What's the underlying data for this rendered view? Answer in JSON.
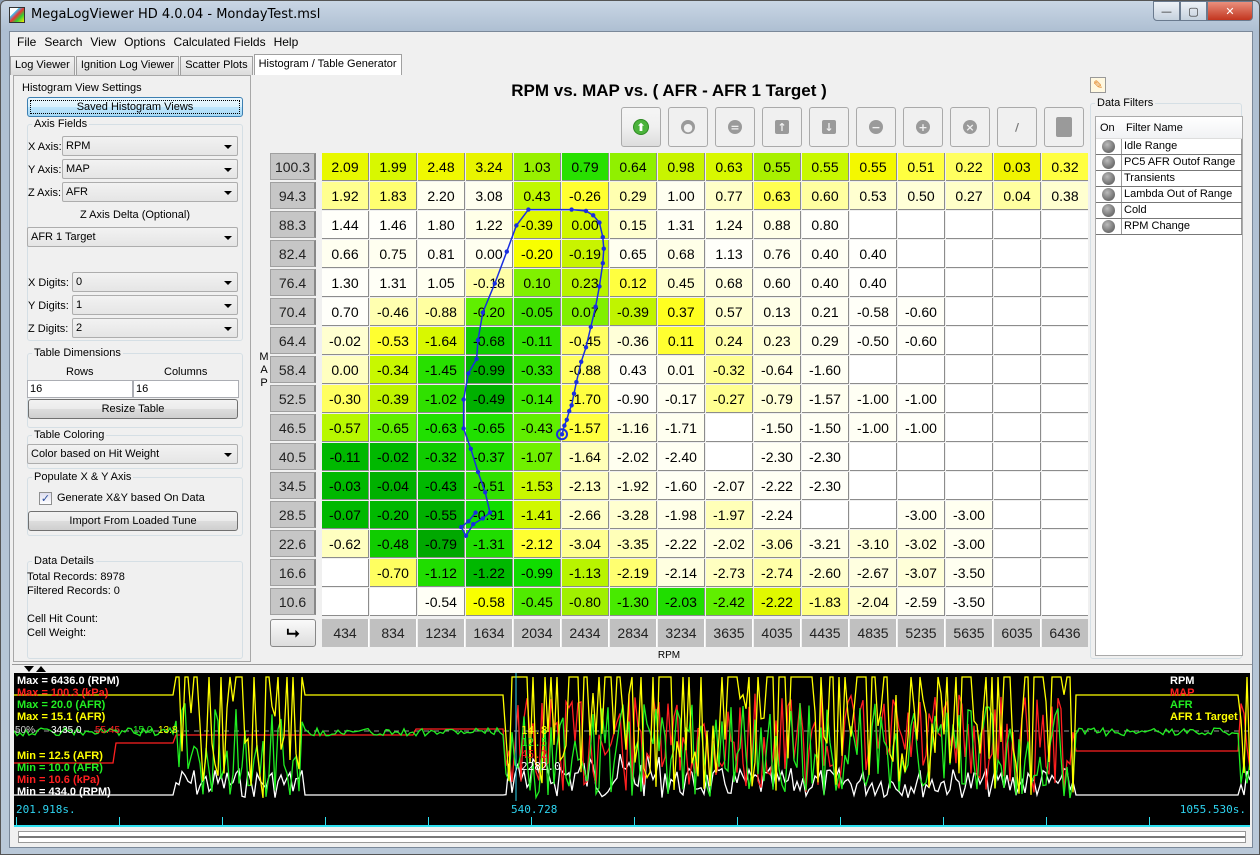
{
  "window": {
    "title": "MegaLogViewer HD 4.0.04 - MondayTest.msl",
    "buttons": {
      "minimize": "—",
      "maximize": "▢",
      "close": "✕"
    }
  },
  "menu": [
    "File",
    "Search",
    "View",
    "Options",
    "Calculated Fields",
    "Help"
  ],
  "tabs": [
    {
      "label": "Log Viewer",
      "active": false
    },
    {
      "label": "Ignition Log Viewer",
      "active": false
    },
    {
      "label": "Scatter Plots",
      "active": false
    },
    {
      "label": "Histogram / Table Generator",
      "active": true
    }
  ],
  "settings": {
    "group_title": "Histogram View Settings",
    "saved_views_button": "Saved Histogram Views",
    "axis_fields": {
      "title": "Axis Fields",
      "x_label": "X Axis:",
      "x_value": "RPM",
      "y_label": "Y Axis:",
      "y_value": "MAP",
      "z_label": "Z Axis:",
      "z_value": "AFR",
      "z_delta_label": "Z Axis Delta (Optional)",
      "z_delta_value": "AFR 1 Target",
      "x_digits_label": "X Digits:",
      "x_digits": "0",
      "y_digits_label": "Y Digits:",
      "y_digits": "1",
      "z_digits_label": "Z Digits:",
      "z_digits": "2"
    },
    "table_dimensions": {
      "title": "Table Dimensions",
      "rows_label": "Rows",
      "rows": "16",
      "cols_label": "Columns",
      "cols": "16",
      "resize_button": "Resize Table"
    },
    "table_coloring": {
      "title": "Table Coloring",
      "value": "Color based on Hit Weight"
    },
    "populate": {
      "title": "Populate X & Y Axis",
      "checkbox_label": "Generate X&Y based On Data",
      "checked": true,
      "import_button": "Import From Loaded Tune"
    },
    "data_details": {
      "title": "Data Details",
      "total": "Total Records: 8978",
      "filtered": "Filtered Records: 0",
      "hit_count": "Cell Hit Count:",
      "weight": "Cell Weight:"
    }
  },
  "table": {
    "title": "RPM vs. MAP vs. ( AFR - AFR 1 Target )",
    "x_axis_label": "RPM",
    "y_axis_label": "MAP",
    "toolbar": [
      {
        "name": "go-up-icon",
        "glyph": "⬆",
        "enabled": true
      },
      {
        "name": "go-down-icon",
        "glyph": "●",
        "enabled": false
      },
      {
        "name": "equals-icon",
        "glyph": "=",
        "enabled": false
      },
      {
        "name": "arrow-up-icon",
        "glyph": "↑",
        "enabled": false
      },
      {
        "name": "arrow-down-icon",
        "glyph": "↓",
        "enabled": false
      },
      {
        "name": "minus-icon",
        "glyph": "−",
        "enabled": false
      },
      {
        "name": "plus-icon",
        "glyph": "+",
        "enabled": false
      },
      {
        "name": "x-icon",
        "glyph": "×",
        "enabled": false
      },
      {
        "name": "pencil-icon",
        "glyph": "/",
        "enabled": false
      },
      {
        "name": "fill-icon",
        "glyph": "■",
        "enabled": false
      }
    ],
    "x_values": [
      "434",
      "834",
      "1234",
      "1634",
      "2034",
      "2434",
      "2834",
      "3234",
      "3635",
      "4035",
      "4435",
      "4835",
      "5235",
      "5635",
      "6035",
      "6436"
    ],
    "y_values": [
      "100.3",
      "94.3",
      "88.3",
      "82.4",
      "76.4",
      "70.4",
      "64.4",
      "58.4",
      "52.5",
      "46.5",
      "40.5",
      "34.5",
      "28.5",
      "22.6",
      "16.6",
      "10.6"
    ],
    "cells": [
      [
        "2.09",
        "1.99",
        "2.48",
        "3.24",
        "1.03",
        "0.79",
        "0.64",
        "0.98",
        "0.63",
        "0.55",
        "0.55",
        "0.55",
        "0.51",
        "0.22",
        "0.03",
        "0.32"
      ],
      [
        "1.92",
        "1.83",
        "2.20",
        "3.08",
        "0.43",
        "-0.26",
        "0.29",
        "1.00",
        "0.77",
        "0.63",
        "0.60",
        "0.53",
        "0.50",
        "0.27",
        "0.04",
        "0.38"
      ],
      [
        "1.44",
        "1.46",
        "1.80",
        "1.22",
        "-0.39",
        "0.00",
        "0.15",
        "1.31",
        "1.24",
        "0.88",
        "0.80",
        "",
        "",
        "",
        "",
        ""
      ],
      [
        "0.66",
        "0.75",
        "0.81",
        "0.00",
        "-0.20",
        "-0.19",
        "0.65",
        "0.68",
        "1.13",
        "0.76",
        "0.40",
        "0.40",
        "",
        "",
        "",
        ""
      ],
      [
        "1.30",
        "1.31",
        "1.05",
        "-0.18",
        "0.10",
        "0.23",
        "0.12",
        "0.45",
        "0.68",
        "0.60",
        "0.40",
        "0.40",
        "",
        "",
        "",
        ""
      ],
      [
        "0.70",
        "-0.46",
        "-0.88",
        "-0.20",
        "-0.05",
        "0.07",
        "-0.39",
        "0.37",
        "0.57",
        "0.13",
        "0.21",
        "-0.58",
        "-0.60",
        "",
        "",
        ""
      ],
      [
        "-0.02",
        "-0.53",
        "-1.64",
        "-0.68",
        "-0.11",
        "-0.45",
        "-0.36",
        "0.11",
        "0.24",
        "0.23",
        "0.29",
        "-0.50",
        "-0.60",
        "",
        "",
        ""
      ],
      [
        "0.00",
        "-0.34",
        "-1.45",
        "-0.99",
        "-0.33",
        "-0.88",
        "0.43",
        "0.01",
        "-0.32",
        "-0.64",
        "-1.60",
        "",
        "",
        "",
        "",
        ""
      ],
      [
        "-0.30",
        "-0.39",
        "-1.02",
        "-0.49",
        "-0.14",
        "-1.70",
        "-0.90",
        "-0.17",
        "-0.27",
        "-0.79",
        "-1.57",
        "-1.00",
        "-1.00",
        "",
        "",
        ""
      ],
      [
        "-0.57",
        "-0.65",
        "-0.63",
        "-0.65",
        "-0.43",
        "-1.57",
        "-1.16",
        "-1.71",
        "",
        "-1.50",
        "-1.50",
        "-1.00",
        "-1.00",
        "",
        "",
        ""
      ],
      [
        "-0.11",
        "-0.02",
        "-0.32",
        "-0.37",
        "-1.07",
        "-1.64",
        "-2.02",
        "-2.40",
        "",
        "-2.30",
        "-2.30",
        "",
        "",
        "",
        "",
        ""
      ],
      [
        "-0.03",
        "-0.04",
        "-0.43",
        "-0.51",
        "-1.53",
        "-2.13",
        "-1.92",
        "-1.60",
        "-2.07",
        "-2.22",
        "-2.30",
        "",
        "",
        "",
        "",
        ""
      ],
      [
        "-0.07",
        "-0.20",
        "-0.55",
        "-0.91",
        "-1.41",
        "-2.66",
        "-3.28",
        "-1.98",
        "-1.97",
        "-2.24",
        "",
        "",
        "-3.00",
        "-3.00",
        "",
        ""
      ],
      [
        "-0.62",
        "-0.48",
        "-0.79",
        "-1.31",
        "-2.12",
        "-3.04",
        "-3.35",
        "-2.22",
        "-2.02",
        "-3.06",
        "-3.21",
        "-3.10",
        "-3.02",
        "-3.00",
        "",
        ""
      ],
      [
        "",
        "-0.70",
        "-1.12",
        "-1.22",
        "-0.99",
        "-1.13",
        "-2.19",
        "-2.14",
        "-2.73",
        "-2.74",
        "-2.60",
        "-2.67",
        "-3.07",
        "-3.50",
        "",
        ""
      ],
      [
        "",
        "",
        "-0.54",
        "-0.58",
        "-0.45",
        "-0.80",
        "-1.30",
        "-2.03",
        "-2.42",
        "-2.22",
        "-1.83",
        "-2.04",
        "-2.59",
        "-3.50",
        "",
        ""
      ]
    ],
    "cell_colors": [
      [
        "#e8f800",
        "#d8f800",
        "#f0f800",
        "#e8f400",
        "#98f000",
        "#28e000",
        "#90f000",
        "#c8f400",
        "#d8f800",
        "#a8f000",
        "#c8f800",
        "#f4f800",
        "#ffff40",
        "#ffff60",
        "#f0f400",
        "#ffff40"
      ],
      [
        "#ffff90",
        "#ffff70",
        "#fffff0",
        "#fffff0",
        "#c0f800",
        "#ffff30",
        "#ffffb0",
        "#fffff0",
        "#ffffc8",
        "#ffff50",
        "#ffffa0",
        "#ffffd0",
        "#ffffd8",
        "#ffffc8",
        "#ffffa0",
        "#ffffd0"
      ],
      [
        "#fffffa",
        "#fffffa",
        "#fffff6",
        "#ffffe8",
        "#e0f800",
        "#d0f800",
        "#ffffd0",
        "#fffff4",
        "#ffffe8",
        "#ffffe8",
        "#fffffa",
        "#ffffff",
        "#ffffff",
        "#ffffff",
        "#ffffff",
        "#ffffff"
      ],
      [
        "#fffff0",
        "#fffff0",
        "#fffff6",
        "#fffff0",
        "#f8ff00",
        "#c8f400",
        "#fffff0",
        "#ffffe8",
        "#fffffa",
        "#fffff0",
        "#fffff4",
        "#fffffc",
        "#ffffff",
        "#ffffff",
        "#ffffff",
        "#ffffff"
      ],
      [
        "#fffffa",
        "#fffff6",
        "#fffff0",
        "#ffffa8",
        "#80f000",
        "#b8f400",
        "#ffff40",
        "#ffffd0",
        "#ffffe0",
        "#fffff0",
        "#fffff4",
        "#fffffc",
        "#ffffff",
        "#ffffff",
        "#ffffff",
        "#ffffff"
      ],
      [
        "#fffffa",
        "#ffffb0",
        "#ffffa0",
        "#60ee00",
        "#40e000",
        "#80f000",
        "#c0f400",
        "#ffff20",
        "#ffffd0",
        "#ffffe8",
        "#fffff4",
        "#fffff8",
        "#fffff8",
        "#ffffff",
        "#ffffff",
        "#ffffff"
      ],
      [
        "#ffffd0",
        "#ffff30",
        "#d8f800",
        "#10cc00",
        "#30e000",
        "#ffff60",
        "#ffffd8",
        "#ffff30",
        "#ffffa8",
        "#ffffd8",
        "#fffff0",
        "#fffff8",
        "#fffff8",
        "#ffffff",
        "#ffffff",
        "#ffffff"
      ],
      [
        "#ffffc0",
        "#c8f800",
        "#28e000",
        "#00b000",
        "#30e000",
        "#ffff60",
        "#fffff8",
        "#fffff0",
        "#ffff90",
        "#ffffe0",
        "#fffff4",
        "#ffffff",
        "#ffffff",
        "#ffffff",
        "#ffffff",
        "#ffffff"
      ],
      [
        "#ffff60",
        "#c0f400",
        "#30e000",
        "#00b000",
        "#40e800",
        "#ffff40",
        "#fffffa",
        "#fffff0",
        "#ffff90",
        "#ffffd8",
        "#fffff0",
        "#fffff4",
        "#fffff8",
        "#ffffff",
        "#ffffff",
        "#ffffff"
      ],
      [
        "#b8f800",
        "#60ee00",
        "#20e000",
        "#20e000",
        "#60ee00",
        "#ffff40",
        "#ffffe0",
        "#fffff0",
        "#ffffff",
        "#fffff0",
        "#fffff4",
        "#fffff4",
        "#fffff8",
        "#ffffff",
        "#ffffff",
        "#ffffff"
      ],
      [
        "#00b800",
        "#00b800",
        "#10cc00",
        "#20dd00",
        "#70f000",
        "#ffffb8",
        "#fffff0",
        "#fffff4",
        "#ffffff",
        "#fffff4",
        "#fffff8",
        "#ffffff",
        "#ffffff",
        "#ffffff",
        "#ffffff",
        "#ffffff"
      ],
      [
        "#00b800",
        "#00b000",
        "#00b800",
        "#30e000",
        "#c8f800",
        "#ffffc0",
        "#ffffe0",
        "#fffff4",
        "#fffff0",
        "#fffff4",
        "#fffff8",
        "#ffffff",
        "#ffffff",
        "#ffffff",
        "#ffffff",
        "#ffffff"
      ],
      [
        "#00b800",
        "#00b800",
        "#00b000",
        "#10dd00",
        "#d0f800",
        "#ffffc8",
        "#ffffd0",
        "#ffffe8",
        "#ffffb8",
        "#fffff0",
        "#ffffff",
        "#ffffff",
        "#fffff0",
        "#fffff0",
        "#ffffff",
        "#ffffff"
      ],
      [
        "#ffffc0",
        "#10cc00",
        "#00a800",
        "#20dd00",
        "#ffff30",
        "#ffff90",
        "#ffffb8",
        "#ffffe8",
        "#ffffe0",
        "#ffffc0",
        "#ffffe8",
        "#ffffd8",
        "#ffffe0",
        "#fffff0",
        "#ffffff",
        "#ffffff"
      ],
      [
        "#ffffff",
        "#ffff60",
        "#20dd00",
        "#00b800",
        "#10dd00",
        "#b8f400",
        "#ffff70",
        "#ffffe0",
        "#ffffc0",
        "#ffffa8",
        "#ffffd0",
        "#ffffe0",
        "#ffffd8",
        "#fffff0",
        "#ffffff",
        "#ffffff"
      ],
      [
        "#ffffff",
        "#ffffff",
        "#fffff6",
        "#f8ff00",
        "#50ea00",
        "#a0f000",
        "#48ea00",
        "#20dd00",
        "#60ee00",
        "#e0f800",
        "#ffff80",
        "#ffffd0",
        "#fffff0",
        "#fffffa",
        "#ffffff",
        "#ffffff"
      ]
    ],
    "trace_color": "#1a2ee0"
  },
  "filters": {
    "title": "Data Filters",
    "col_on": "On",
    "col_name": "Filter Name",
    "items": [
      "Idle Range",
      "PC5 AFR Outof Range",
      "Transients",
      "Lambda Out of Range",
      "Cold",
      "RPM Change"
    ]
  },
  "scope": {
    "max_labels": [
      {
        "text": "Max = 6436.0 (RPM)",
        "color": "#ffffff"
      },
      {
        "text": "Max = 100.3 (kPa)",
        "color": "#ff2020"
      },
      {
        "text": "Max = 20.0 (AFR)",
        "color": "#22ee22"
      },
      {
        "text": "Max = 15.1 (AFR)",
        "color": "#ffff00"
      }
    ],
    "min_labels": [
      {
        "text": "Min = 12.5 (AFR)",
        "color": "#ffff00"
      },
      {
        "text": "Min = 10.0 (AFR)",
        "color": "#22ee22"
      },
      {
        "text": "Min = 10.6 (kPa)",
        "color": "#ff2020"
      },
      {
        "text": "Min = 434.0 (RPM)",
        "color": "#ffffff"
      }
    ],
    "mid_line": [
      {
        "text": "50%",
        "color": "#cccccc"
      },
      {
        "text": "3435.0",
        "color": "#ffffff"
      },
      {
        "text": "55.45",
        "color": "#ff2020"
      },
      {
        "text": "15.0",
        "color": "#22ee22"
      },
      {
        "text": "13.8",
        "color": "#ffff00"
      }
    ],
    "cursor_values": [
      {
        "text": "14.8",
        "color": "#ffff00"
      },
      {
        "text": "12.5",
        "color": "#22ee22"
      },
      {
        "text": "45.2",
        "color": "#ff2020"
      },
      {
        "text": "2282.0",
        "color": "#ffffff"
      }
    ],
    "legend": [
      {
        "text": "RPM",
        "color": "#ffffff"
      },
      {
        "text": "MAP",
        "color": "#ff2020"
      },
      {
        "text": "AFR",
        "color": "#22ee22"
      },
      {
        "text": "AFR 1 Target",
        "color": "#ffff00"
      }
    ],
    "time_start": "201.918s.",
    "time_cursor": "540.728",
    "time_end": "1055.530s."
  }
}
